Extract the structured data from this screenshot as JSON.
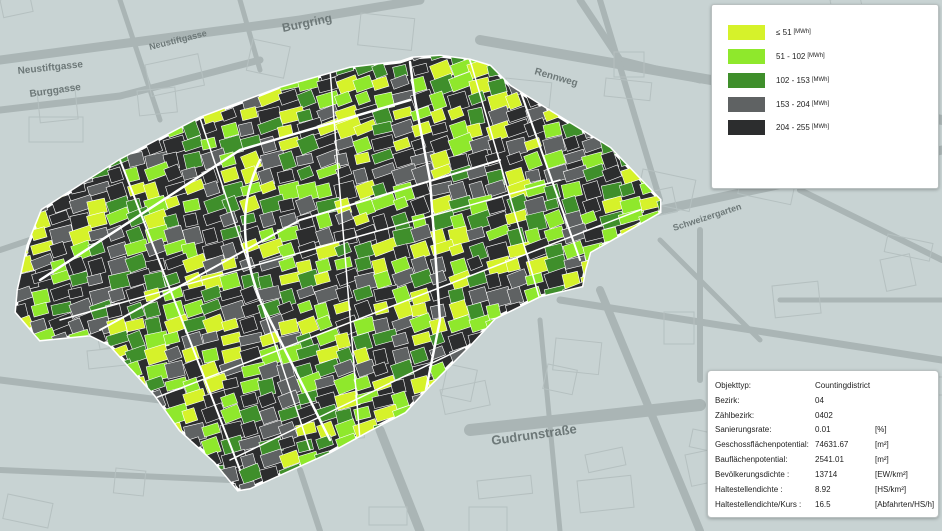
{
  "map": {
    "street_labels": [
      "Burgring",
      "Neustiftgasse",
      "Burggasse",
      "Neustiftgasse",
      "Rennweg",
      "Schweizergarten",
      "Gudrunstraße"
    ],
    "colors": {
      "background": "#c8d3d3",
      "road": "#aab5b5",
      "district_outline": "#ffffff",
      "class_colors": [
        "#d6f22a",
        "#8fe82c",
        "#3f8f2b",
        "#5f6263",
        "#2c2d2e"
      ]
    }
  },
  "legend": {
    "items": [
      {
        "label": "≤ 51",
        "unit": "[MWh]",
        "color": "#d6f22a"
      },
      {
        "label": "51 - 102",
        "unit": "[MWh]",
        "color": "#8fe82c"
      },
      {
        "label": "102 - 153",
        "unit": "[MWh]",
        "color": "#3f8f2b"
      },
      {
        "label": "153 - 204",
        "unit": "[MWh]",
        "color": "#5f6263"
      },
      {
        "label": "204 - 255",
        "unit": "[MWh]",
        "color": "#2c2d2e"
      }
    ]
  },
  "info_panel": {
    "rows": [
      {
        "key": "Objekttyp:",
        "value": "Countingdistrict",
        "unit": ""
      },
      {
        "key": "Bezirk:",
        "value": "04",
        "unit": ""
      },
      {
        "key": "Zählbezirk:",
        "value": "0402",
        "unit": ""
      },
      {
        "key": "Sanierungsrate:",
        "value": "0.01",
        "unit": "[%]"
      },
      {
        "key": "Geschossflächenpotential:",
        "value": "74631.67",
        "unit": "[m²]"
      },
      {
        "key": "Bauflächenpotential:",
        "value": "2541.01",
        "unit": "[m²]"
      },
      {
        "key": "Bevölkerungsdichte :",
        "value": "13714",
        "unit": "[EW/km²]"
      },
      {
        "key": "Haltestellendichte :",
        "value": "8.92",
        "unit": "[HS/km²]"
      },
      {
        "key": "Haltestellendichte/Kurs :",
        "value": "16.5",
        "unit": "[Abfahrten/HS/h]"
      }
    ]
  }
}
